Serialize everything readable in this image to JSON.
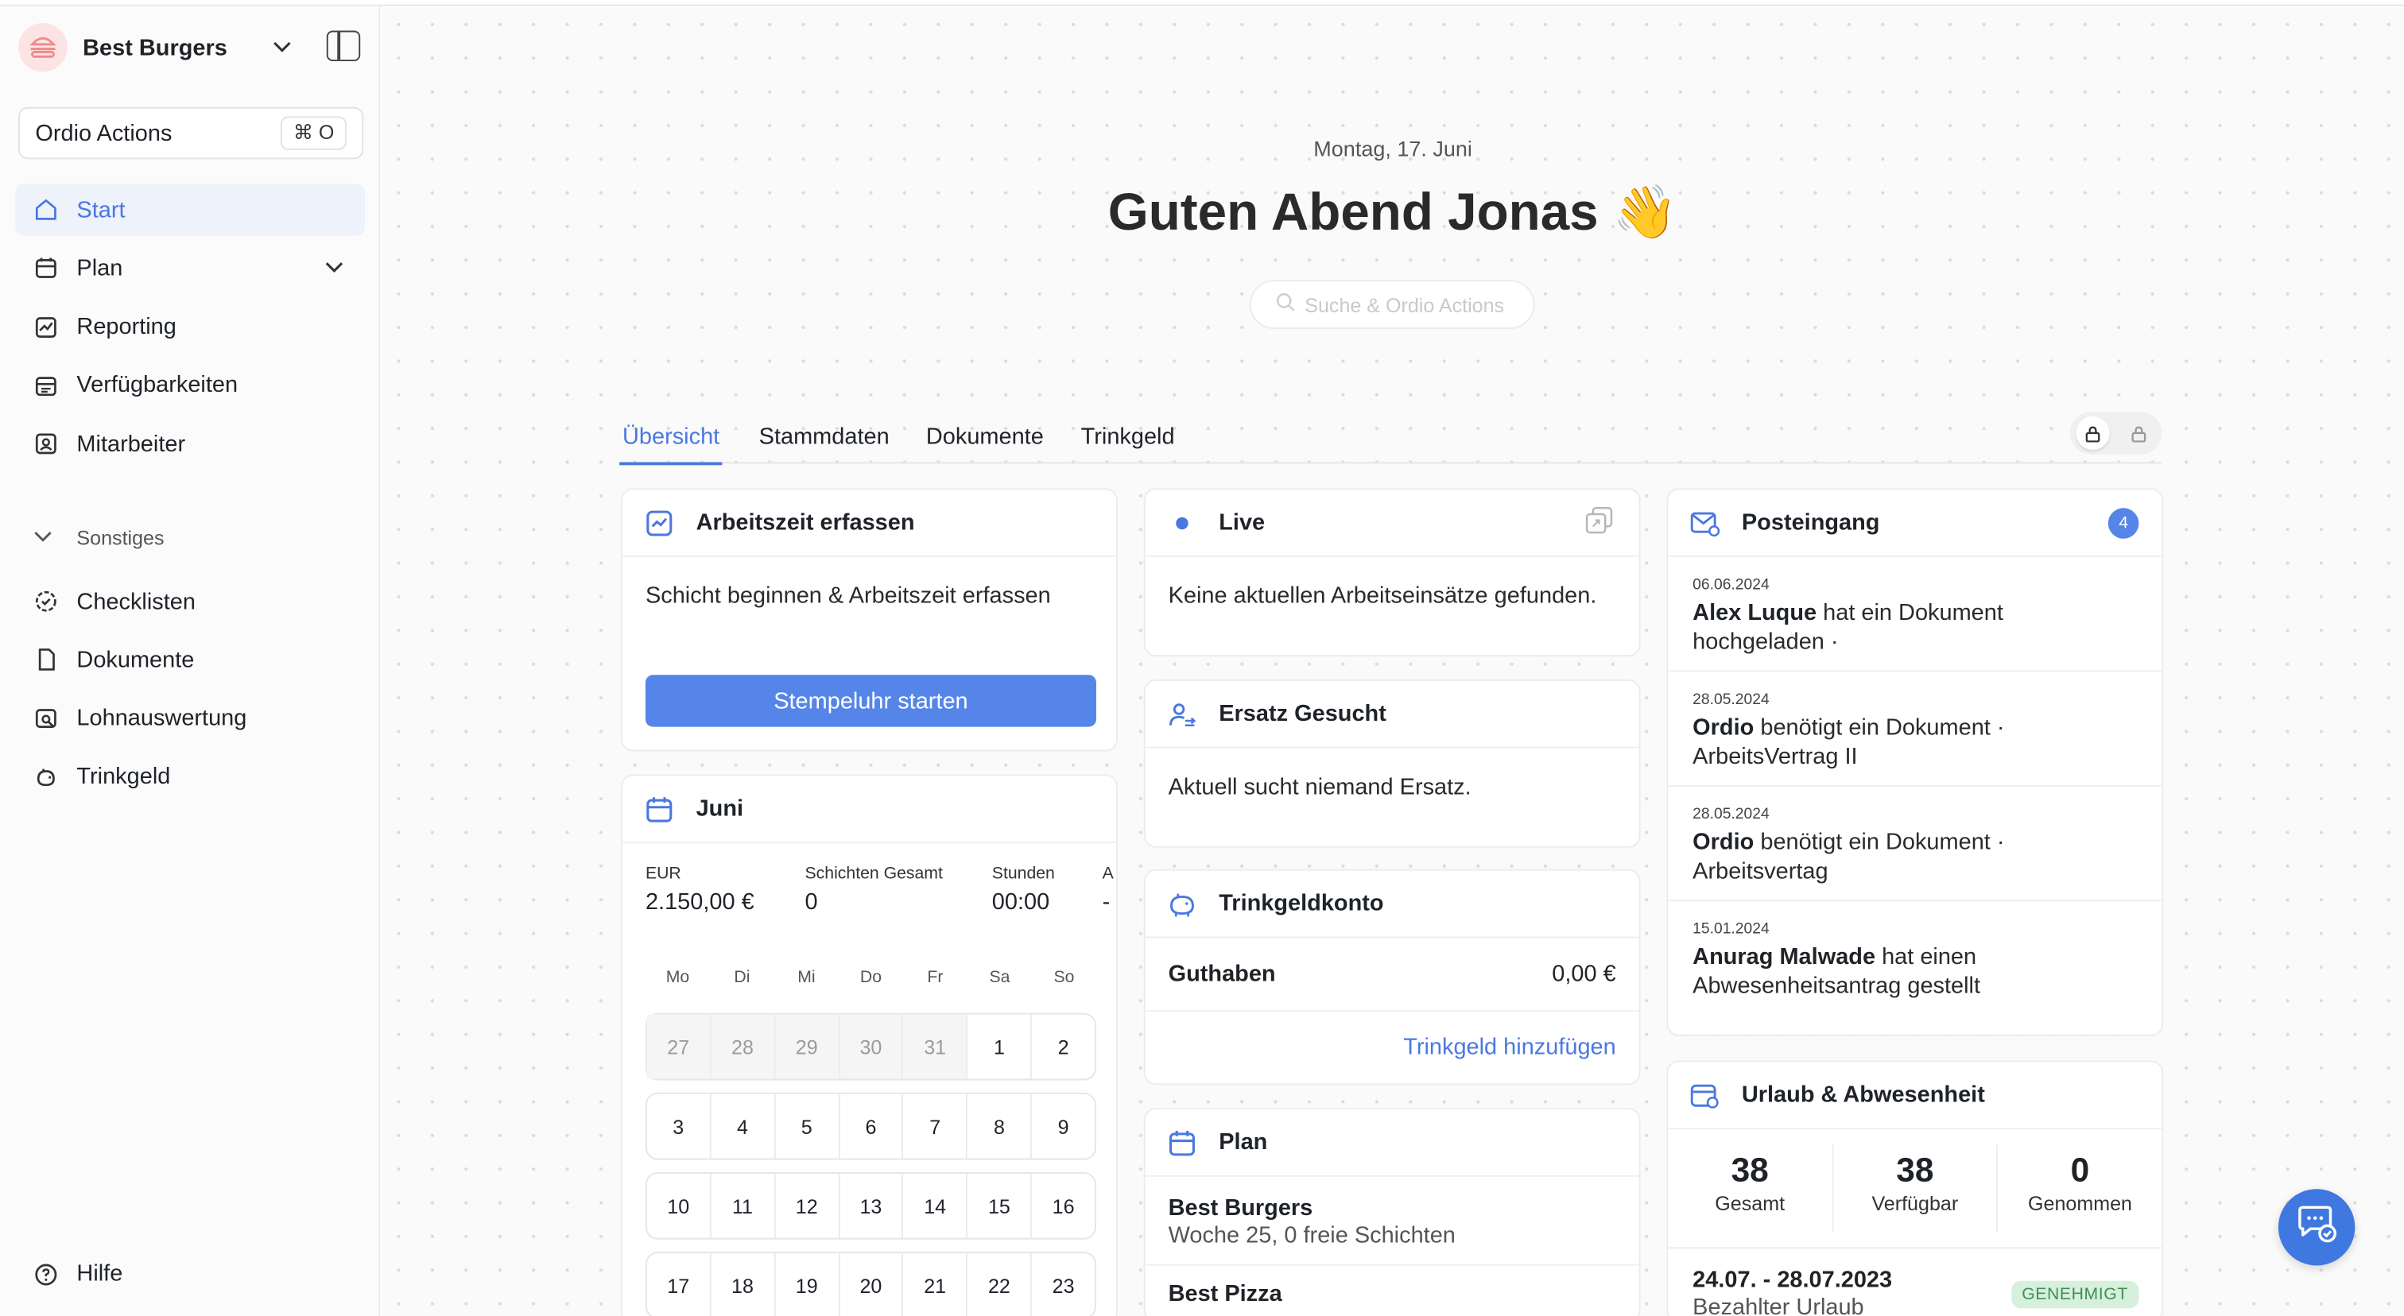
{
  "brand": {
    "name": "Best Burgers"
  },
  "actions": {
    "label": "Ordio Actions",
    "shortcut": "⌘ O"
  },
  "nav": {
    "items": [
      {
        "label": "Start",
        "icon": "home-icon"
      },
      {
        "label": "Plan",
        "icon": "calendar-icon"
      },
      {
        "label": "Reporting",
        "icon": "chart-icon"
      },
      {
        "label": "Verfügbarkeiten",
        "icon": "availability-icon"
      },
      {
        "label": "Mitarbeiter",
        "icon": "employee-icon"
      }
    ],
    "section": "Sonstiges",
    "items2": [
      {
        "label": "Checklisten",
        "icon": "checklist-icon"
      },
      {
        "label": "Dokumente",
        "icon": "document-icon"
      },
      {
        "label": "Lohnauswertung",
        "icon": "payroll-icon"
      },
      {
        "label": "Trinkgeld",
        "icon": "tip-icon"
      }
    ],
    "help": "Hilfe"
  },
  "header": {
    "date": "Montag, 17. Juni",
    "greeting": "Guten Abend Jonas 👋",
    "search_placeholder": "Suche & Ordio Actions"
  },
  "tabs": [
    "Übersicht",
    "Stammdaten",
    "Dokumente",
    "Trinkgeld"
  ],
  "worktime": {
    "title": "Arbeitszeit erfassen",
    "text": "Schicht beginnen & Arbeitszeit erfassen",
    "button": "Stempeluhr starten"
  },
  "month": {
    "title": "Juni",
    "stats": [
      {
        "label": "EUR",
        "value": "2.150,00 €"
      },
      {
        "label": "Schichten Gesamt",
        "value": "0"
      },
      {
        "label": "Stunden",
        "value": "00:00"
      },
      {
        "label": "A",
        "value": "-"
      }
    ],
    "weekdays": [
      "Mo",
      "Di",
      "Mi",
      "Do",
      "Fr",
      "Sa",
      "So"
    ],
    "weeks": [
      [
        "27",
        "28",
        "29",
        "30",
        "31",
        "1",
        "2"
      ],
      [
        "3",
        "4",
        "5",
        "6",
        "7",
        "8",
        "9"
      ],
      [
        "10",
        "11",
        "12",
        "13",
        "14",
        "15",
        "16"
      ],
      [
        "17",
        "18",
        "19",
        "20",
        "21",
        "22",
        "23"
      ]
    ]
  },
  "live": {
    "title": "Live",
    "text": "Keine aktuellen Arbeitseinsätze gefunden."
  },
  "replacement": {
    "title": "Ersatz Gesucht",
    "text": "Aktuell sucht niemand Ersatz."
  },
  "tips": {
    "title": "Trinkgeldkonto",
    "balance_label": "Guthaben",
    "balance_value": "0,00 €",
    "add_link": "Trinkgeld hinzufügen"
  },
  "plan": {
    "title": "Plan",
    "items": [
      {
        "name": "Best Burgers",
        "sub": "Woche 25, 0 freie Schichten"
      },
      {
        "name": "Best Pizza",
        "sub": ""
      }
    ]
  },
  "inbox": {
    "title": "Posteingang",
    "count": "4",
    "items": [
      {
        "date": "06.06.2024",
        "who": "Alex Luque",
        "text": " hat ein Dokument hochgeladen ·"
      },
      {
        "date": "28.05.2024",
        "who": "Ordio",
        "text": " benötigt ein Dokument · ArbeitsVertrag II"
      },
      {
        "date": "28.05.2024",
        "who": "Ordio",
        "text": " benötigt ein Dokument · Arbeitsvertag"
      },
      {
        "date": "15.01.2024",
        "who": "Anurag Malwade",
        "text": " hat einen Abwesenheitsantrag gestellt"
      }
    ]
  },
  "absence": {
    "title": "Urlaub & Abwesenheit",
    "stats": [
      {
        "value": "38",
        "label": "Gesamt"
      },
      {
        "value": "38",
        "label": "Verfügbar"
      },
      {
        "value": "0",
        "label": "Genommen"
      }
    ],
    "entry_range": "24.07. - 28.07.2023",
    "entry_type": "Bezahlter Urlaub",
    "entry_status": "GENEHMIGT"
  }
}
